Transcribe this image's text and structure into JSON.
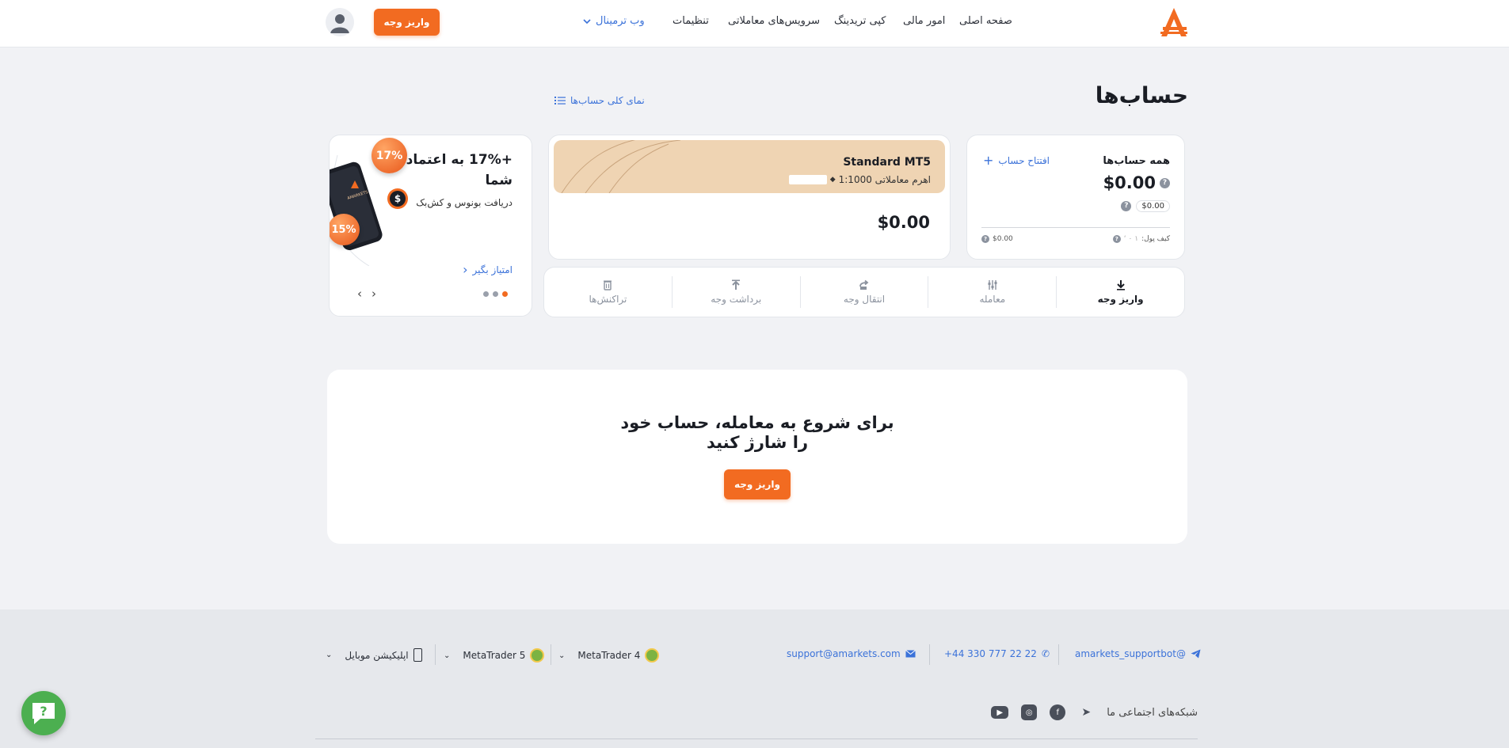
{
  "header": {
    "nav": {
      "home": "صفحه اصلی",
      "finance": "امور مالی",
      "copy_trading": "کپی تریدینگ",
      "trading_services": "سرویس‌های معاملاتی",
      "settings": "تنظیمات",
      "web_terminal": "وب ترمینال"
    },
    "deposit_label": "واریز وجه"
  },
  "page": {
    "title": "حساب‌ها",
    "overview_link": "نمای کلی حساب‌ها"
  },
  "all_accounts": {
    "title": "همه حساب‌ها",
    "open_account": "افتتاح حساب",
    "total": "$0.00",
    "secondary": "$0.00",
    "wallet_label": "کیف پول:",
    "wallet_mask": "۱ ۰ ‘",
    "wallet_value": "$0.00"
  },
  "mt5_account": {
    "name": "Standard MT5",
    "leverage_label": "اهرم معاملاتی 1:1000",
    "balance": "$0.00"
  },
  "actions": [
    {
      "label": "واریز وجه",
      "icon": "download-icon"
    },
    {
      "label": "معامله",
      "icon": "sliders-icon"
    },
    {
      "label": "انتقال وجه",
      "icon": "transfer-icon"
    },
    {
      "label": "برداشت وجه",
      "icon": "upload-icon"
    },
    {
      "label": "تراکنش‌ها",
      "icon": "trash-icon"
    }
  ],
  "promo": {
    "headline": "+17% به اعتماد شما",
    "subtitle": "دریافت بونوس و کش‌بک",
    "link": "امتیاز بگیر",
    "badge_top": "17%",
    "badge_bottom": "15%",
    "phone_brand": "AMARKETS"
  },
  "cta": {
    "message": "برای شروع به معامله، حساب خود را شارژ کنید",
    "button": "واریز وجه"
  },
  "footer": {
    "telegram_bot": "@amarkets_supportbot",
    "phone": "+44 330 777 22 22",
    "email": "support@amarkets.com",
    "mt4": "MetaTrader 4",
    "mt5": "MetaTrader 5",
    "mobile_app": "اپلیکیشن موبایل",
    "social_label": "شبکه‌های اجتماعی ما"
  },
  "colors": {
    "accent": "#f26b21",
    "link": "#3b72d9",
    "card_band": "#efd4b3",
    "help_button": "#4caf50"
  }
}
